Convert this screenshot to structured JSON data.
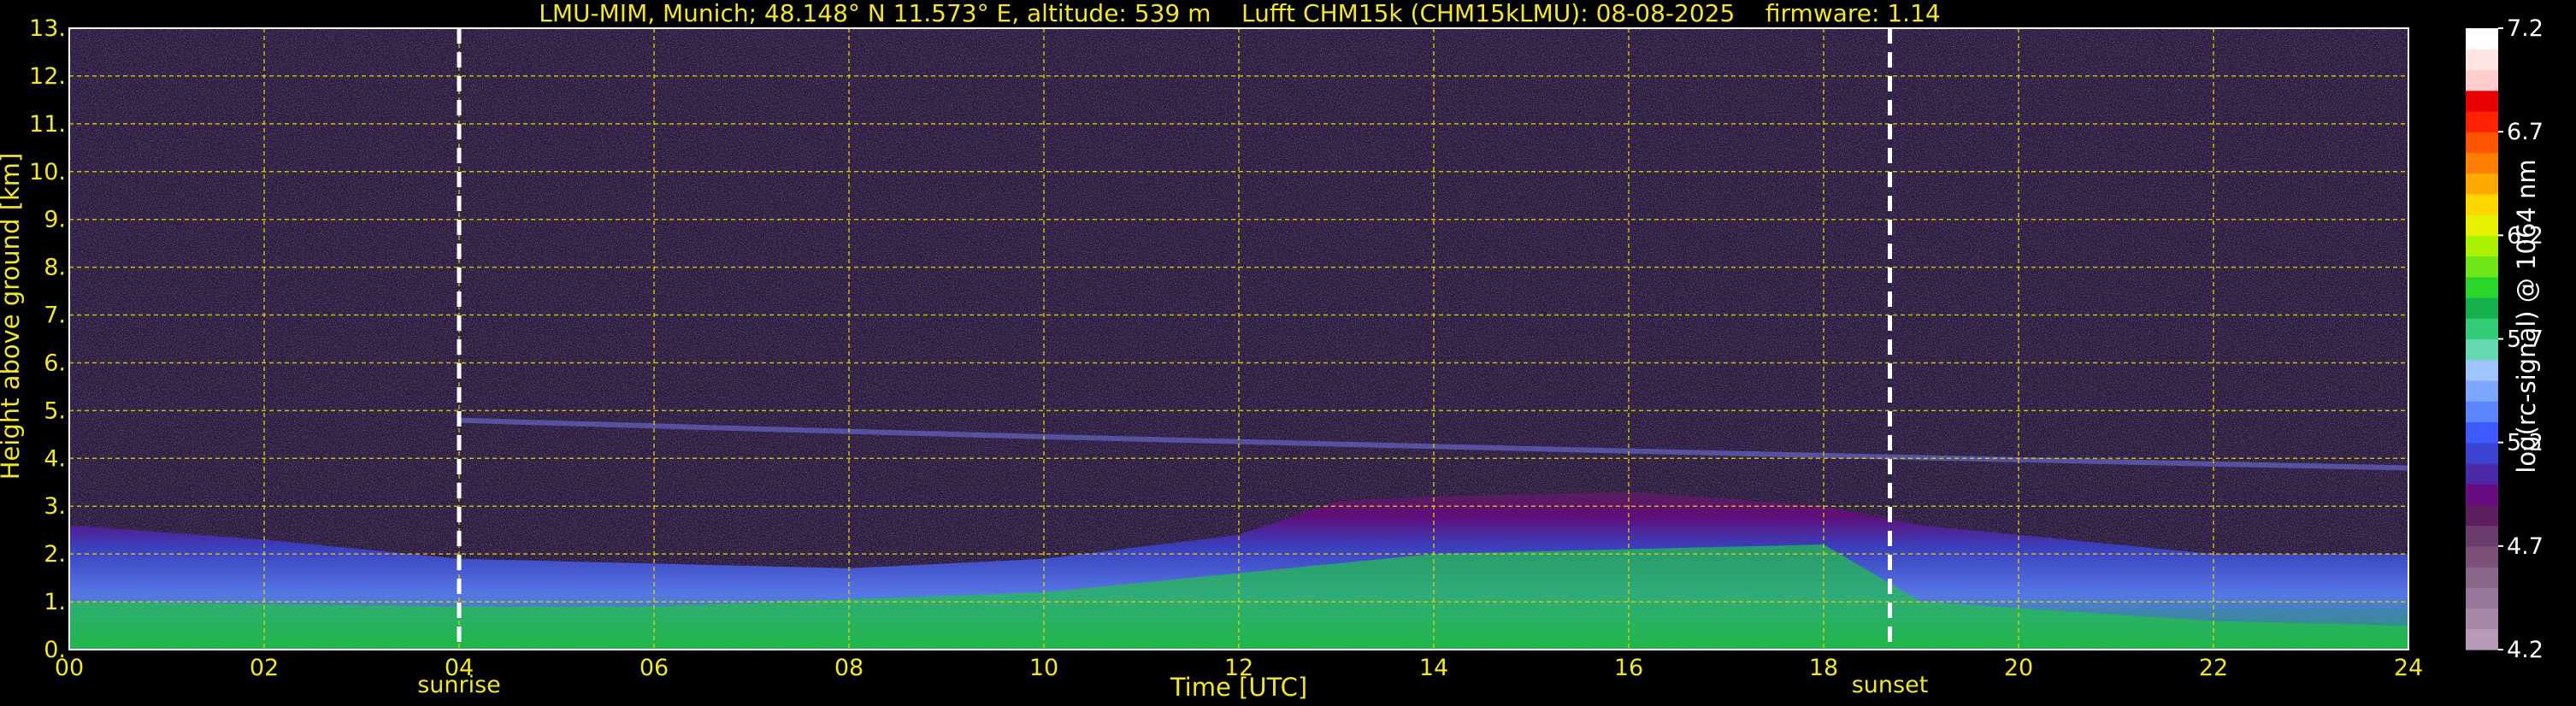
{
  "chart_data": {
    "type": "heatmap",
    "title": "LMU-MIM, Munich; 48.148° N 11.573° E, altitude: 539 m    Lufft CHM15k (CHM15kLMU): 08-08-2025    firmware: 1.14",
    "xlabel": "Time [UTC]",
    "ylabel": "Height above ground [km]",
    "xlim": [
      0,
      24
    ],
    "ylim": [
      0,
      13
    ],
    "x_ticks": [
      "00",
      "02",
      "04",
      "06",
      "08",
      "10",
      "12",
      "14",
      "16",
      "18",
      "20",
      "22",
      "24"
    ],
    "y_ticks": [
      "0.",
      "1.",
      "2.",
      "3.",
      "4.",
      "5.",
      "6.",
      "7.",
      "8.",
      "9.",
      "10.",
      "11.",
      "12.",
      "13."
    ],
    "grid": true,
    "colorbar": {
      "label": "log(rc-signal) @ 1064 nm",
      "range": [
        4.2,
        7.2
      ],
      "ticks": [
        "4.2",
        "4.7",
        "5.2",
        "5.7",
        "6.2",
        "6.7",
        "7.2"
      ],
      "colors": [
        "#b59bb5",
        "#a689a6",
        "#97789a",
        "#886789",
        "#7a5079",
        "#6b3c6b",
        "#5e1f5e",
        "#680a80",
        "#4a2aa6",
        "#3b44d1",
        "#3d5bff",
        "#5b86ff",
        "#7da6ff",
        "#a0c4ff",
        "#66d9b3",
        "#33cc77",
        "#16b04d",
        "#29d629",
        "#6ee619",
        "#aaf200",
        "#e6f000",
        "#ffd500",
        "#ffaa00",
        "#ff8000",
        "#ff5500",
        "#ff2200",
        "#e60000",
        "#ffcccc",
        "#ffe4e4",
        "#ffffff"
      ]
    },
    "annotations": [
      {
        "label": "sunrise",
        "x": 4.0
      },
      {
        "label": "sunset",
        "x": 18.68
      }
    ]
  }
}
